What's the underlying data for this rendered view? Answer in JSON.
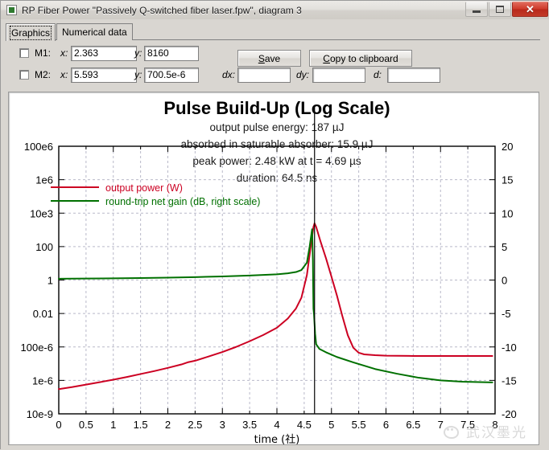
{
  "window": {
    "title": "RP Fiber Power \"Passively Q-switched fiber laser.fpw\", diagram 3",
    "icon": "app-icon",
    "buttons": {
      "minimize": "minimize-icon",
      "maximize": "maximize-icon",
      "close": "✕"
    }
  },
  "tabs": [
    {
      "label": "Graphics",
      "active": true
    },
    {
      "label": "Numerical data",
      "active": false
    }
  ],
  "markers": [
    {
      "name": "M1:",
      "checked": false,
      "x_label": "x:",
      "x_value": "2.363",
      "y_label": "y:",
      "y_value": "8160"
    },
    {
      "name": "M2:",
      "checked": false,
      "x_label": "x:",
      "x_value": "5.593",
      "y_label": "y:",
      "y_value": "700.5e-6"
    }
  ],
  "toolbar": {
    "save_label": "Save",
    "save_accel": "S",
    "copy_label": "Copy to clipboard",
    "copy_accel": "C"
  },
  "deltas": [
    {
      "label": "dx:",
      "value": ""
    },
    {
      "label": "dy:",
      "value": ""
    },
    {
      "label": "d:",
      "value": ""
    }
  ],
  "chart_data": {
    "type": "line",
    "title": "Pulse Build-Up (Log Scale)",
    "annotations": [
      "output pulse energy: 187 µJ",
      "absorbed in saturable absorber: 15.9 µJ",
      "peak power: 2.48 kW at t = 4.69 µs",
      "duration: 64.5 ns"
    ],
    "xlabel": "time (社)",
    "ylabel_left": "",
    "ylabel_right": "",
    "grid": true,
    "legend_position": "upper-left-inside",
    "legend": [
      {
        "name": "output power (W)",
        "color": "#cc0022"
      },
      {
        "name": "round-trip net gain (dB, right scale)",
        "color": "#007000"
      }
    ],
    "x": {
      "min": 0,
      "max": 8,
      "ticks": [
        0,
        0.5,
        1,
        1.5,
        2,
        2.5,
        3,
        3.5,
        4,
        4.5,
        5,
        5.5,
        6,
        6.5,
        7,
        7.5,
        8
      ],
      "tick_labels": [
        "0",
        "0.5",
        "1",
        "1.5",
        "2",
        "2.5",
        "3",
        "3.5",
        "4",
        "4.5",
        "5",
        "5.5",
        "6",
        "6.5",
        "7",
        "7.5",
        "8"
      ]
    },
    "y_left": {
      "scale": "log",
      "ticks": [
        100000000.0,
        1000000.0,
        10000.0,
        100,
        1,
        0.01,
        0.0001,
        1e-06,
        1e-08
      ],
      "tick_labels": [
        "100e6",
        "1e6",
        "10e3",
        "100",
        "1",
        "0.01",
        "100e-6",
        "1e-6",
        "10e-9"
      ],
      "min": 1e-08,
      "max": 100000000.0
    },
    "y_right": {
      "scale": "linear",
      "ticks": [
        20,
        15,
        10,
        5,
        0,
        -5,
        -10,
        -15,
        -20
      ],
      "tick_labels": [
        "20",
        "15",
        "10",
        "5",
        "0",
        "-5",
        "-10",
        "-15",
        "-20"
      ],
      "min": -20,
      "max": 20
    },
    "marker_line_x": 4.69,
    "series": [
      {
        "name": "output power (W)",
        "axis": "left",
        "color": "#cc0022",
        "points": [
          [
            0.0,
            3e-07
          ],
          [
            0.25,
            4e-07
          ],
          [
            0.5,
            5.6e-07
          ],
          [
            0.75,
            7.8e-07
          ],
          [
            1.0,
            1.1e-06
          ],
          [
            1.25,
            1.6e-06
          ],
          [
            1.5,
            2.4e-06
          ],
          [
            1.75,
            3.6e-06
          ],
          [
            2.0,
            5.6e-06
          ],
          [
            2.25,
            9e-06
          ],
          [
            2.363,
            1.2e-05
          ],
          [
            2.5,
            1.5e-05
          ],
          [
            2.75,
            2.7e-05
          ],
          [
            3.0,
            5e-05
          ],
          [
            3.25,
            0.0001
          ],
          [
            3.5,
            0.00022
          ],
          [
            3.75,
            0.00052
          ],
          [
            4.0,
            0.0014
          ],
          [
            4.2,
            0.005
          ],
          [
            4.35,
            0.02
          ],
          [
            4.45,
            0.09
          ],
          [
            4.55,
            2.0
          ],
          [
            4.62,
            100.0
          ],
          [
            4.67,
            1500.0
          ],
          [
            4.69,
            2480.0
          ],
          [
            4.72,
            1500.0
          ],
          [
            4.8,
            200.0
          ],
          [
            4.9,
            20.0
          ],
          [
            5.0,
            1.6
          ],
          [
            5.1,
            0.12
          ],
          [
            5.2,
            0.007
          ],
          [
            5.3,
            0.0005
          ],
          [
            5.4,
            9e-05
          ],
          [
            5.5,
            4.5e-05
          ],
          [
            5.6,
            3.6e-05
          ],
          [
            5.8,
            3.2e-05
          ],
          [
            6.0,
            3e-05
          ],
          [
            6.5,
            2.9e-05
          ],
          [
            7.0,
            2.9e-05
          ],
          [
            7.5,
            2.9e-05
          ],
          [
            7.95,
            2.9e-05
          ]
        ]
      },
      {
        "name": "round-trip net gain (dB, right scale)",
        "axis": "right",
        "color": "#007000",
        "points": [
          [
            0.0,
            0.2
          ],
          [
            0.5,
            0.22
          ],
          [
            1.0,
            0.26
          ],
          [
            1.5,
            0.3
          ],
          [
            2.0,
            0.36
          ],
          [
            2.5,
            0.44
          ],
          [
            3.0,
            0.54
          ],
          [
            3.5,
            0.68
          ],
          [
            4.0,
            0.86
          ],
          [
            4.2,
            1.0
          ],
          [
            4.35,
            1.2
          ],
          [
            4.45,
            1.5
          ],
          [
            4.55,
            2.6
          ],
          [
            4.6,
            5.0
          ],
          [
            4.645,
            7.6
          ],
          [
            4.66,
            3.0
          ],
          [
            4.665,
            -1.0
          ],
          [
            4.67,
            -4.3
          ],
          [
            4.68,
            -5.1
          ],
          [
            4.7,
            -8.0
          ],
          [
            4.72,
            -9.6
          ],
          [
            4.78,
            -10.3
          ],
          [
            4.9,
            -10.8
          ],
          [
            5.1,
            -11.5
          ],
          [
            5.4,
            -12.3
          ],
          [
            5.8,
            -13.3
          ],
          [
            6.2,
            -14.0
          ],
          [
            6.6,
            -14.6
          ],
          [
            7.0,
            -15.0
          ],
          [
            7.4,
            -15.2
          ],
          [
            7.95,
            -15.3
          ]
        ]
      }
    ]
  },
  "watermark": {
    "text": "武汉墨光",
    "logo": "owl-logo"
  }
}
